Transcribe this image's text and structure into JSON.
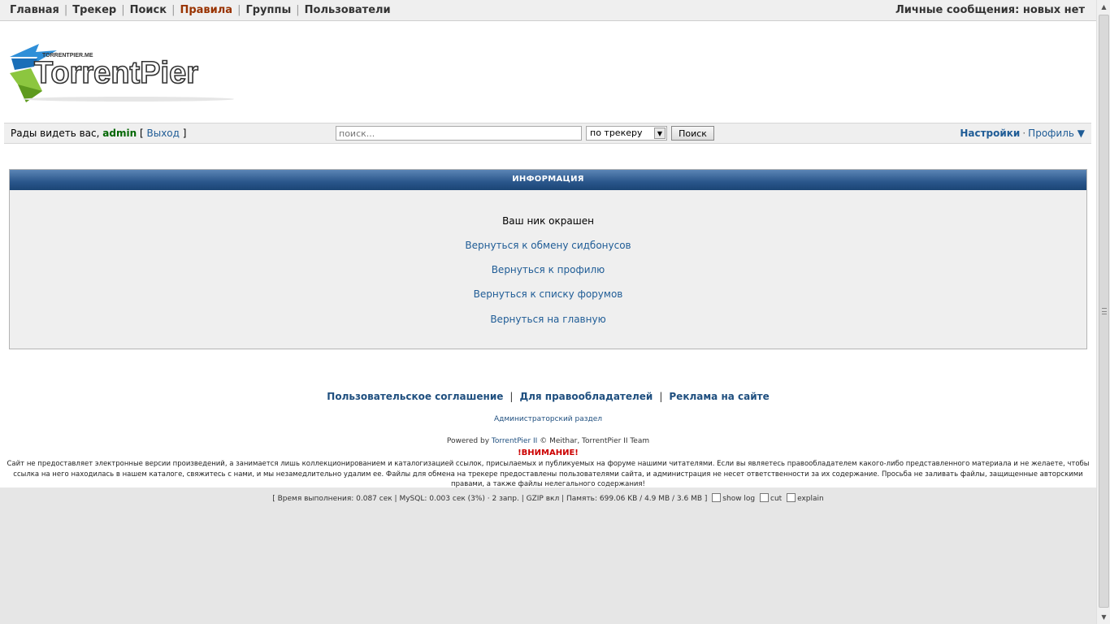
{
  "topnav": {
    "links": [
      {
        "label": "Главная",
        "active": false
      },
      {
        "label": "Трекер",
        "active": false
      },
      {
        "label": "Поиск",
        "active": false
      },
      {
        "label": "Правила",
        "active": true
      },
      {
        "label": "Группы",
        "active": false
      },
      {
        "label": "Пользователи",
        "active": false
      }
    ],
    "private_messages": "Личные сообщения: новых нет"
  },
  "logo": {
    "name": "TorrentPier",
    "subtitle": "TORRENTPIER.ME"
  },
  "userbar": {
    "greeting": "Рады видеть вас,",
    "username": "admin",
    "bracket_open": "[",
    "logout": "Выход",
    "bracket_close": "]",
    "search_placeholder": "поиск...",
    "search_scope": "по трекеру",
    "search_button": "Поиск",
    "settings": "Настройки",
    "dot": "·",
    "profile": "Профиль ▼"
  },
  "info": {
    "header": "ИНФОРМАЦИЯ",
    "message": "Ваш ник окрашен",
    "links": [
      "Вернуться к обмену сидбонусов",
      "Вернуться к профилю",
      "Вернуться к списку форумов",
      "Вернуться на главную"
    ]
  },
  "footer": {
    "links": [
      "Пользовательское соглашение",
      "Для правообладателей",
      "Реклама на сайте"
    ],
    "separator": "|",
    "admin_link": "Администраторский раздел",
    "powered_prefix": "Powered by",
    "powered_link": "TorrentPier II",
    "powered_suffix": "© Meithar, TorrentPier II Team",
    "warning_title": "!ВНИМАНИЕ!",
    "warning_text": "Сайт не предоставляет электронные версии произведений, а занимается лишь коллекционированием и каталогизацией ссылок, присылаемых и публикуемых на форуме нашими читателями. Если вы являетесь правообладателем какого-либо представленного материала и не желаете, чтобы ссылка на него находилась в нашем каталоге, свяжитесь с нами, и мы незамедлительно удалим ее. Файлы для обмена на трекере предоставлены пользователями сайта, и администрация не несет ответственности за их содержание. Просьба не заливать файлы, защищенные авторскими правами, а также файлы нелегального содержания!"
  },
  "debug": {
    "text": "[  Время выполнения: 0.087 сек  |  MySQL: 0.003 сек (3%) · 2 запр.  |  GZIP вкл  |  Память: 699.06 KB / 4.9 MB / 3.6 MB  ]",
    "show_log": "show log",
    "cut": "cut",
    "explain": "explain"
  }
}
